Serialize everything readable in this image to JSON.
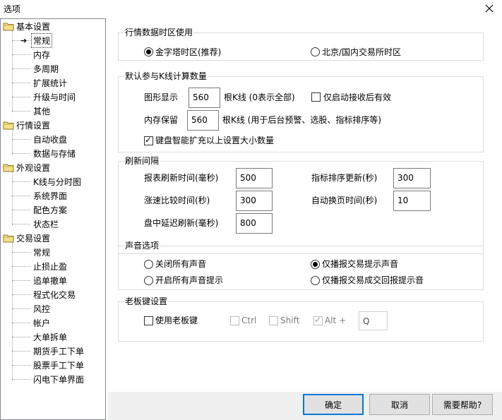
{
  "window": {
    "title": "选项"
  },
  "tree": {
    "groups": [
      {
        "label": "基本设置",
        "items": [
          "常规",
          "内存",
          "多周期",
          "扩展统计",
          "升级与时间",
          "其他"
        ]
      },
      {
        "label": "行情设置",
        "items": [
          "自动收盘",
          "数据与存储"
        ]
      },
      {
        "label": "外观设置",
        "items": [
          "K线与分时图",
          "系统界面",
          "配色方案",
          "状态栏"
        ]
      },
      {
        "label": "交易设置",
        "items": [
          "常规",
          "止损止盈",
          "追单撤单",
          "程式化交易",
          "风控",
          "帐户",
          "大单拆单",
          "期货手工下单",
          "股票手工下单",
          "闪电下单界面"
        ]
      }
    ],
    "selected_arrow": "➔"
  },
  "timezone": {
    "title": "行情数据时区使用",
    "option1": "金字塔时区(推荐)",
    "option2": "北京/国内交易所时区",
    "selected": "option1"
  },
  "kline": {
    "title": "默认参与K线计算数量",
    "display_label": "图形显示",
    "display_value": "560",
    "display_unit": "根K线 (0表示全部)",
    "receive_label": "仅启动接收后有效",
    "receive_checked": false,
    "memory_label": "内存保留",
    "memory_value": "560",
    "memory_unit": "根K线 (用于后台预警、选股、指标排序等)",
    "keyboard_label": "键盘智能扩充以上设置大小数量",
    "keyboard_checked": true
  },
  "refresh": {
    "title": "刷新间隔",
    "quote_label": "报表刷新时间(毫秒)",
    "quote_value": "500",
    "rank_label": "指标排序更新(秒)",
    "rank_value": "300",
    "rise_label": "涨速比较时间(秒)",
    "rise_value": "300",
    "page_label": "自动换页时间(秒)",
    "page_value": "10",
    "delay_label": "盘中延迟刷新(毫秒)",
    "delay_value": "800"
  },
  "sound": {
    "title": "声音选项",
    "close_all": "关闭所有声音",
    "trade_only": "仅播报交易提示声音",
    "open_all": "开启所有声音提示",
    "trade_return": "仅播报交易成交回报提示音",
    "selected": "trade_only"
  },
  "boss": {
    "title": "老板键设置",
    "use_label": "使用老板键",
    "use_checked": false,
    "ctrl": "Ctrl",
    "shift": "Shift",
    "alt": "Alt +",
    "alt_checked": true,
    "key": "Q"
  },
  "buttons": {
    "ok": "确定",
    "cancel": "取消",
    "help": "需要帮助?"
  },
  "colors": {
    "default_button_border": "#0078d7",
    "tree_border": "#828790"
  }
}
